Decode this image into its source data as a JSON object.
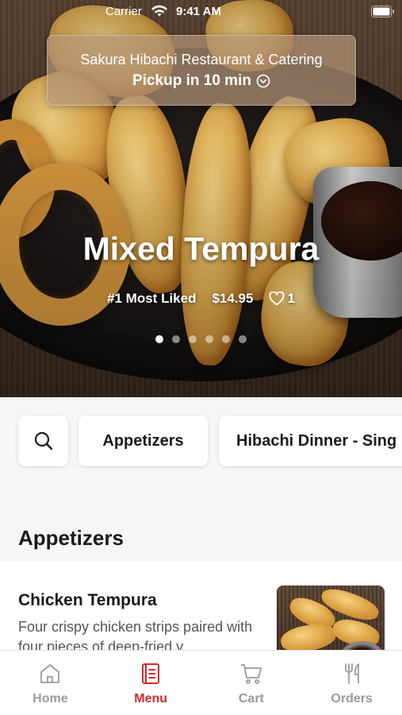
{
  "status_bar": {
    "carrier": "Carrier",
    "time": "9:41 AM"
  },
  "restaurant": {
    "name": "Sakura Hibachi Restaurant & Catering",
    "pickup": "Pickup in 10 min"
  },
  "hero": {
    "title": "Mixed Tempura",
    "badge": "#1 Most Liked",
    "price": "$14.95",
    "likes": "1",
    "slide_count": 6,
    "active_slide": 1
  },
  "categories": {
    "search_icon": "search-icon",
    "items": [
      "Appetizers",
      "Hibachi Dinner - Sing"
    ]
  },
  "section": {
    "title": "Appetizers",
    "items": [
      {
        "name": "Chicken Tempura",
        "description": "Four crispy chicken strips paired with four pieces of deep-fried v..."
      }
    ]
  },
  "tabbar": {
    "active": "Menu",
    "tabs": [
      {
        "label": "Home",
        "icon": "home-icon"
      },
      {
        "label": "Menu",
        "icon": "menu-icon"
      },
      {
        "label": "Cart",
        "icon": "cart-icon"
      },
      {
        "label": "Orders",
        "icon": "fork-knife-icon"
      }
    ]
  },
  "colors": {
    "accent": "#d52b2b",
    "inactive": "#9a9a9a"
  }
}
